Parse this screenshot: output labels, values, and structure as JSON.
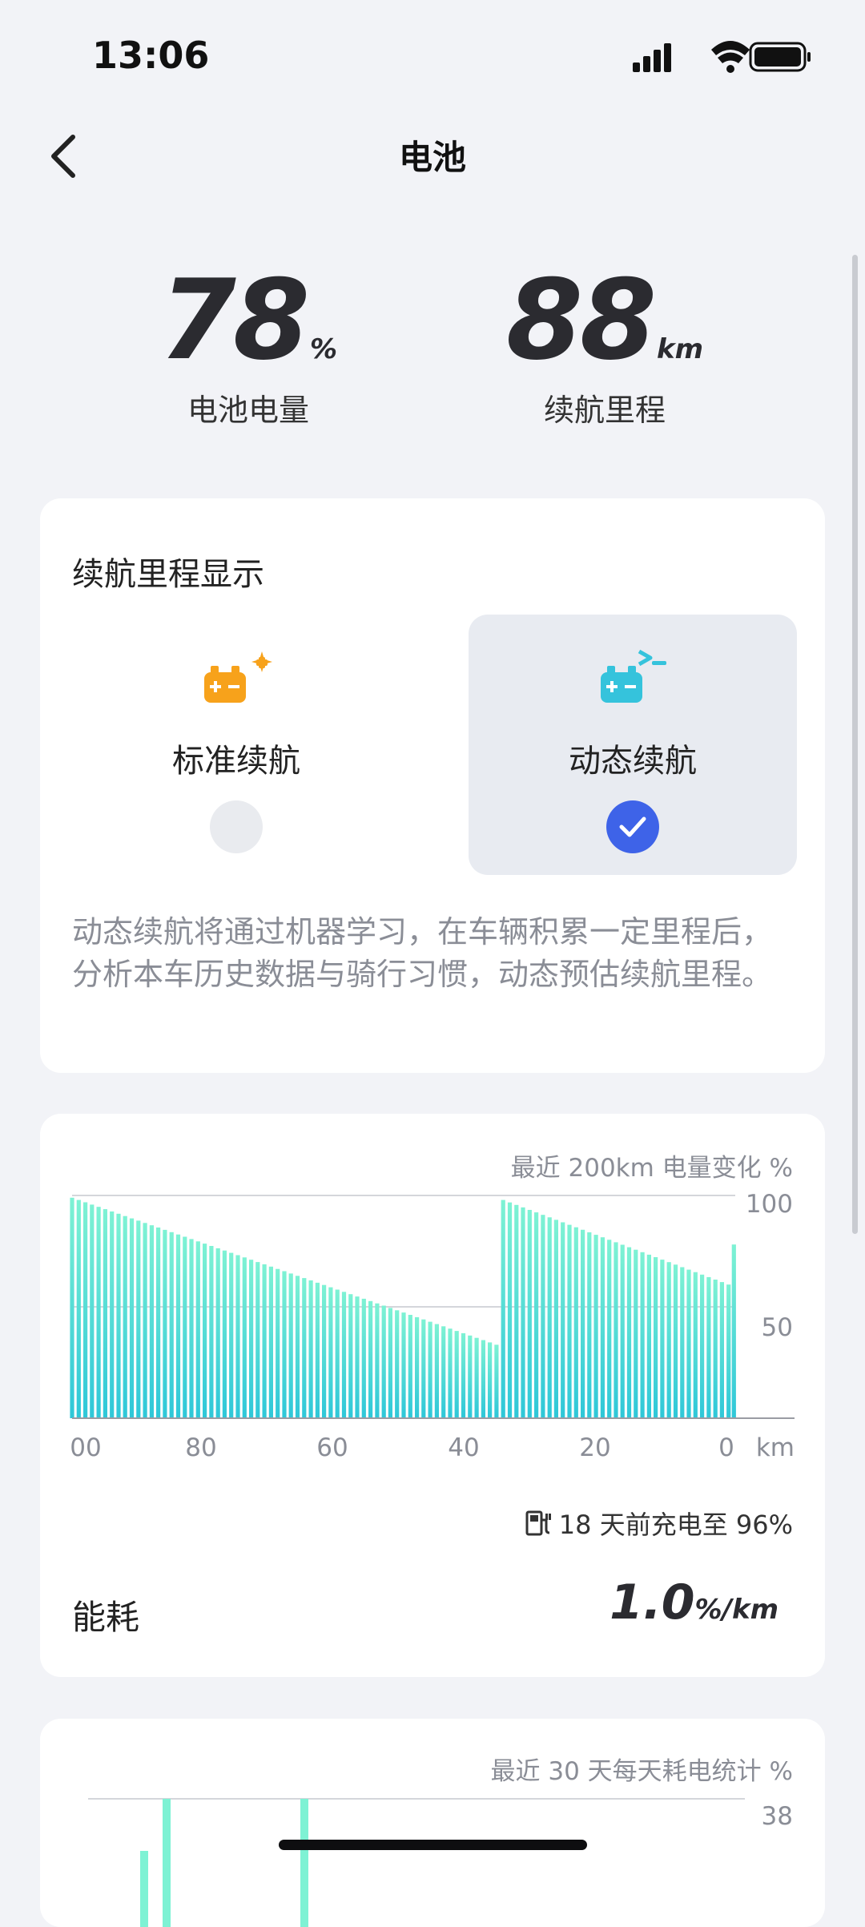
{
  "status": {
    "time": "13:06"
  },
  "nav": {
    "title": "电池"
  },
  "summary": {
    "battery": {
      "value": "78",
      "unit": "%",
      "label": "电池电量"
    },
    "range": {
      "value": "88",
      "unit": "km",
      "label": "续航里程"
    }
  },
  "range_display": {
    "title": "续航里程显示",
    "options": [
      {
        "label": "标准续航",
        "selected": false,
        "icon": "battery-plus-icon",
        "color": "#F7A21B"
      },
      {
        "label": "动态续航",
        "selected": true,
        "icon": "battery-dynamic-icon",
        "color": "#35C3DC"
      }
    ],
    "description": "动态续航将通过机器学习，在车辆积累一定里程后，分析本车历史数据与骑行习惯，动态预估续航里程。"
  },
  "battery_chart": {
    "title": "最近 200km 电量变化 %",
    "charge_note": "18 天前充电至 96%",
    "energy_label": "能耗",
    "energy_value": "1.0",
    "energy_unit": "%/km"
  },
  "daily_chart": {
    "title": "最近 30 天每天耗电统计 %"
  },
  "chart_data": [
    {
      "type": "bar",
      "title": "最近 200km 电量变化 %",
      "x_unit": "km",
      "x_ticks": [
        "00",
        "80",
        "60",
        "40",
        "20",
        "0"
      ],
      "y_ticks": [
        "100",
        "50"
      ],
      "ylim": [
        0,
        100
      ],
      "x_direction": "descending",
      "segments": [
        {
          "from_km": 100,
          "to_km": 36,
          "start_pct": 99,
          "end_pct": 33
        },
        {
          "from_km": 35,
          "to_km": 1,
          "start_pct": 98,
          "end_pct": 60
        }
      ],
      "last_bar_pct": 78,
      "bar_color": "#2EC7D8",
      "bar_top_color": "#7EF2D4"
    },
    {
      "type": "bar",
      "title": "最近 30 天每天耗电统计 %",
      "y_ticks": [
        "38"
      ],
      "bar_color": "#7EF2D4"
    }
  ]
}
